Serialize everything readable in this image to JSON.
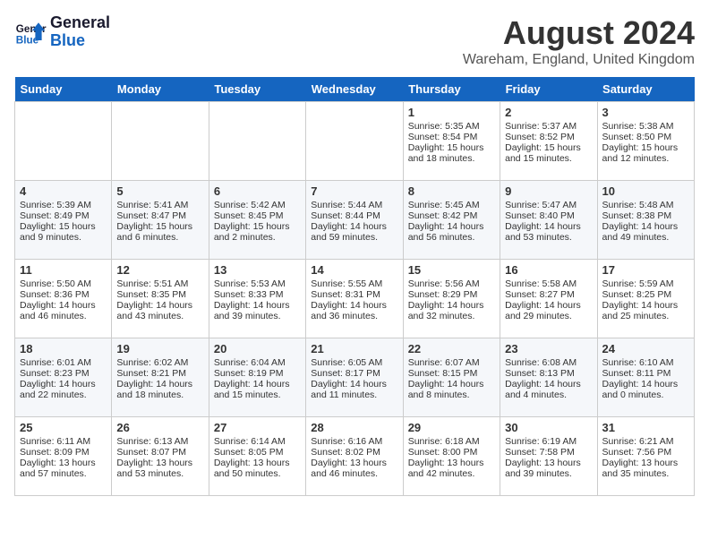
{
  "header": {
    "logo_line1": "General",
    "logo_line2": "Blue",
    "month_year": "August 2024",
    "location": "Wareham, England, United Kingdom"
  },
  "days_of_week": [
    "Sunday",
    "Monday",
    "Tuesday",
    "Wednesday",
    "Thursday",
    "Friday",
    "Saturday"
  ],
  "weeks": [
    [
      {
        "day": "",
        "content": ""
      },
      {
        "day": "",
        "content": ""
      },
      {
        "day": "",
        "content": ""
      },
      {
        "day": "",
        "content": ""
      },
      {
        "day": "1",
        "content": "Sunrise: 5:35 AM\nSunset: 8:54 PM\nDaylight: 15 hours\nand 18 minutes."
      },
      {
        "day": "2",
        "content": "Sunrise: 5:37 AM\nSunset: 8:52 PM\nDaylight: 15 hours\nand 15 minutes."
      },
      {
        "day": "3",
        "content": "Sunrise: 5:38 AM\nSunset: 8:50 PM\nDaylight: 15 hours\nand 12 minutes."
      }
    ],
    [
      {
        "day": "4",
        "content": "Sunrise: 5:39 AM\nSunset: 8:49 PM\nDaylight: 15 hours\nand 9 minutes."
      },
      {
        "day": "5",
        "content": "Sunrise: 5:41 AM\nSunset: 8:47 PM\nDaylight: 15 hours\nand 6 minutes."
      },
      {
        "day": "6",
        "content": "Sunrise: 5:42 AM\nSunset: 8:45 PM\nDaylight: 15 hours\nand 2 minutes."
      },
      {
        "day": "7",
        "content": "Sunrise: 5:44 AM\nSunset: 8:44 PM\nDaylight: 14 hours\nand 59 minutes."
      },
      {
        "day": "8",
        "content": "Sunrise: 5:45 AM\nSunset: 8:42 PM\nDaylight: 14 hours\nand 56 minutes."
      },
      {
        "day": "9",
        "content": "Sunrise: 5:47 AM\nSunset: 8:40 PM\nDaylight: 14 hours\nand 53 minutes."
      },
      {
        "day": "10",
        "content": "Sunrise: 5:48 AM\nSunset: 8:38 PM\nDaylight: 14 hours\nand 49 minutes."
      }
    ],
    [
      {
        "day": "11",
        "content": "Sunrise: 5:50 AM\nSunset: 8:36 PM\nDaylight: 14 hours\nand 46 minutes."
      },
      {
        "day": "12",
        "content": "Sunrise: 5:51 AM\nSunset: 8:35 PM\nDaylight: 14 hours\nand 43 minutes."
      },
      {
        "day": "13",
        "content": "Sunrise: 5:53 AM\nSunset: 8:33 PM\nDaylight: 14 hours\nand 39 minutes."
      },
      {
        "day": "14",
        "content": "Sunrise: 5:55 AM\nSunset: 8:31 PM\nDaylight: 14 hours\nand 36 minutes."
      },
      {
        "day": "15",
        "content": "Sunrise: 5:56 AM\nSunset: 8:29 PM\nDaylight: 14 hours\nand 32 minutes."
      },
      {
        "day": "16",
        "content": "Sunrise: 5:58 AM\nSunset: 8:27 PM\nDaylight: 14 hours\nand 29 minutes."
      },
      {
        "day": "17",
        "content": "Sunrise: 5:59 AM\nSunset: 8:25 PM\nDaylight: 14 hours\nand 25 minutes."
      }
    ],
    [
      {
        "day": "18",
        "content": "Sunrise: 6:01 AM\nSunset: 8:23 PM\nDaylight: 14 hours\nand 22 minutes."
      },
      {
        "day": "19",
        "content": "Sunrise: 6:02 AM\nSunset: 8:21 PM\nDaylight: 14 hours\nand 18 minutes."
      },
      {
        "day": "20",
        "content": "Sunrise: 6:04 AM\nSunset: 8:19 PM\nDaylight: 14 hours\nand 15 minutes."
      },
      {
        "day": "21",
        "content": "Sunrise: 6:05 AM\nSunset: 8:17 PM\nDaylight: 14 hours\nand 11 minutes."
      },
      {
        "day": "22",
        "content": "Sunrise: 6:07 AM\nSunset: 8:15 PM\nDaylight: 14 hours\nand 8 minutes."
      },
      {
        "day": "23",
        "content": "Sunrise: 6:08 AM\nSunset: 8:13 PM\nDaylight: 14 hours\nand 4 minutes."
      },
      {
        "day": "24",
        "content": "Sunrise: 6:10 AM\nSunset: 8:11 PM\nDaylight: 14 hours\nand 0 minutes."
      }
    ],
    [
      {
        "day": "25",
        "content": "Sunrise: 6:11 AM\nSunset: 8:09 PM\nDaylight: 13 hours\nand 57 minutes."
      },
      {
        "day": "26",
        "content": "Sunrise: 6:13 AM\nSunset: 8:07 PM\nDaylight: 13 hours\nand 53 minutes."
      },
      {
        "day": "27",
        "content": "Sunrise: 6:14 AM\nSunset: 8:05 PM\nDaylight: 13 hours\nand 50 minutes."
      },
      {
        "day": "28",
        "content": "Sunrise: 6:16 AM\nSunset: 8:02 PM\nDaylight: 13 hours\nand 46 minutes."
      },
      {
        "day": "29",
        "content": "Sunrise: 6:18 AM\nSunset: 8:00 PM\nDaylight: 13 hours\nand 42 minutes."
      },
      {
        "day": "30",
        "content": "Sunrise: 6:19 AM\nSunset: 7:58 PM\nDaylight: 13 hours\nand 39 minutes."
      },
      {
        "day": "31",
        "content": "Sunrise: 6:21 AM\nSunset: 7:56 PM\nDaylight: 13 hours\nand 35 minutes."
      }
    ]
  ]
}
